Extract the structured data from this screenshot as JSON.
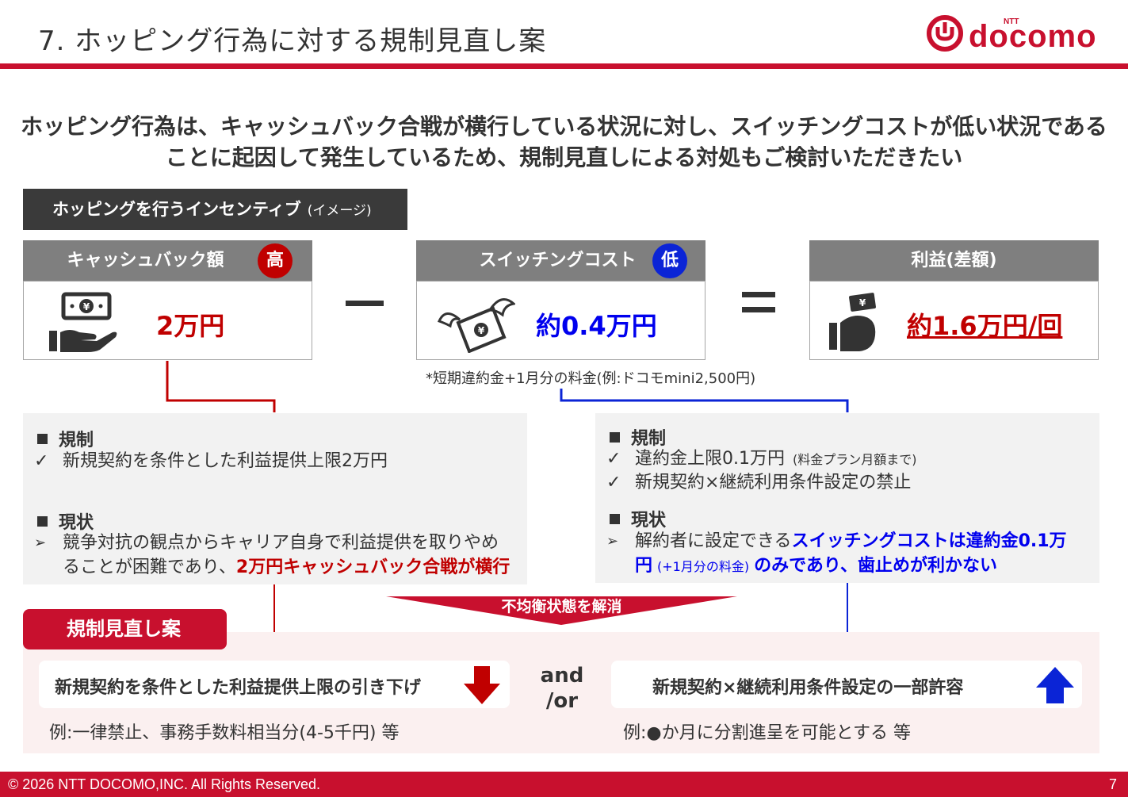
{
  "header": {
    "title": "7. ホッピング行為に対する規制見直し案",
    "brand": "docomo",
    "brand_ntt": "NTT"
  },
  "headline": {
    "line1": "ホッピング行為は、キャッシュバック合戦が横行している状況に対し、スイッチングコストが低い状況である",
    "line2": "ことに起因して発生しているため、規制見直しによる対処もご検討いただきたい"
  },
  "incentive": {
    "label": "ホッピングを行うインセンティブ",
    "label_note": "(イメージ)",
    "cashback": {
      "title": "キャッシュバック額",
      "badge": "高",
      "amount": "2万円"
    },
    "minus": "ー",
    "switching": {
      "title": "スイッチングコスト",
      "badge": "低",
      "amount": "約0.4万円"
    },
    "equals": "=",
    "profit": {
      "title": "利益(差額)",
      "amount": "約1.6万円/回"
    },
    "note": "*短期違約金+1月分の料金(例:ドコモmini2,500円)"
  },
  "left_panel": {
    "reg_title": "規制",
    "reg_item": "新規契約を条件とした利益提供上限2万円",
    "status_title": "現状",
    "status_line1": "競争対抗の観点からキャリア自身で利益提供を取りやめ",
    "status_line2_a": "ることが困難であり、",
    "status_line2_b": "2万円キャッシュバック合戦が横行"
  },
  "right_panel": {
    "reg_title": "規制",
    "reg_item1": "違約金上限0.1万円",
    "reg_item1_note": "(料金プラン月額まで)",
    "reg_item2": "新規契約×継続利用条件設定の禁止",
    "status_title": "現状",
    "status_line1_a": "解約者に設定できる",
    "status_line1_b": "スイッチングコストは違約金0.1万",
    "status_line2_a": "円",
    "status_line2_b": "(+1月分の料金)",
    "status_line2_c": "のみであり、歯止めが利かない"
  },
  "proposal": {
    "banner": "不均衡状態を解消",
    "label": "規制見直し案",
    "left_box": "新規契約を条件とした利益提供上限の引き下げ",
    "left_example": "例:一律禁止、事務手数料相当分(4-5千円) 等",
    "and_or_1": "and",
    "and_or_2": "/or",
    "right_box": "新規契約×継続利用条件設定の一部許容",
    "right_example": "例:●か月に分割進呈を可能とする 等"
  },
  "footer": {
    "copyright": "© 2026 NTT DOCOMO,INC. All Rights Reserved.",
    "page": "7"
  },
  "colors": {
    "brand_red": "#c8102e",
    "accent_red": "#c00000",
    "accent_blue": "#0000ee",
    "arrow_blue": "#0b24d6",
    "dark": "#3a3a3a",
    "gray": "#7f7f7f"
  }
}
